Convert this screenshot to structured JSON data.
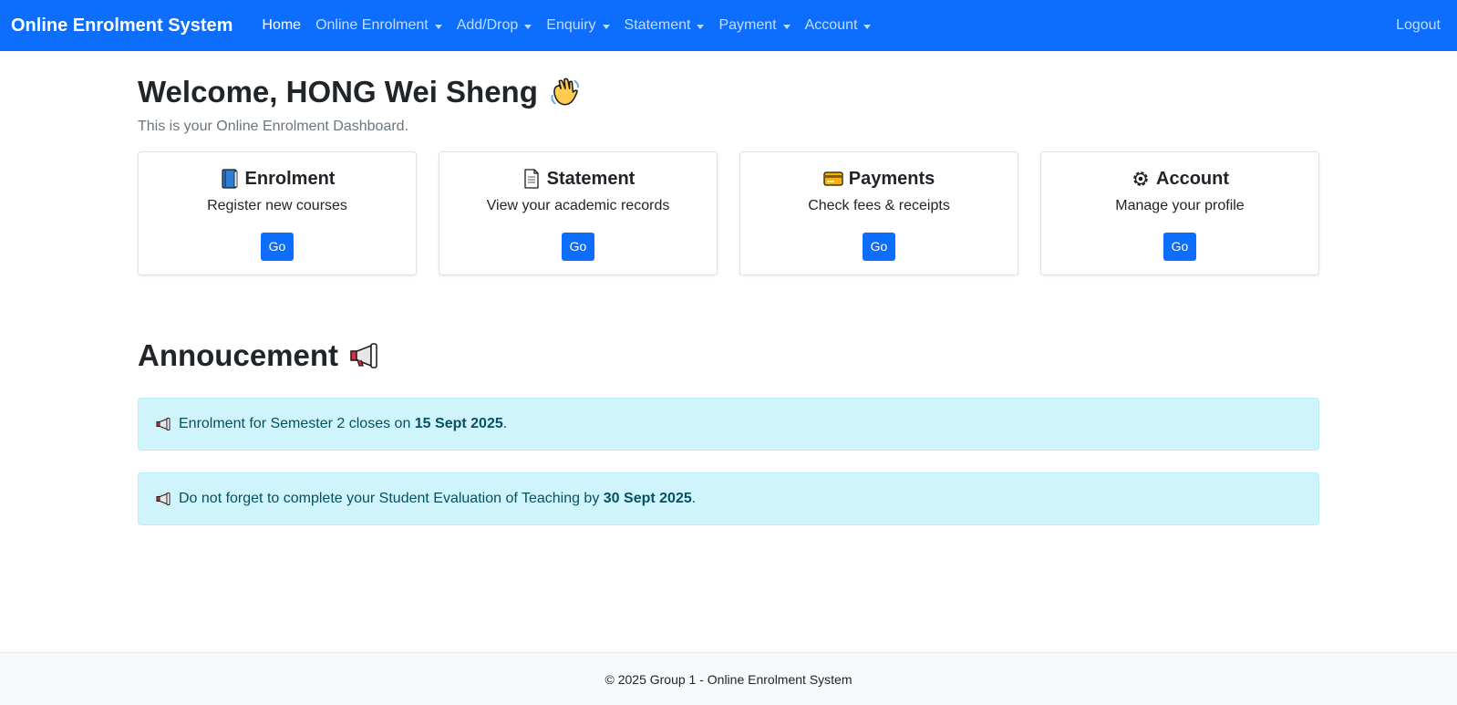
{
  "navbar": {
    "brand": "Online Enrolment System",
    "items": [
      {
        "label": "Home",
        "active": true,
        "dropdown": false
      },
      {
        "label": "Online Enrolment",
        "dropdown": true
      },
      {
        "label": "Add/Drop",
        "dropdown": true
      },
      {
        "label": "Enquiry",
        "dropdown": true
      },
      {
        "label": "Statement",
        "dropdown": true
      },
      {
        "label": "Payment",
        "dropdown": true
      },
      {
        "label": "Account",
        "dropdown": true
      }
    ],
    "logout": "Logout"
  },
  "main": {
    "welcome": "Welcome, HONG Wei Sheng",
    "welcome_icon": "waving-hand-icon",
    "subtitle": "This is your Online Enrolment Dashboard.",
    "cards": [
      {
        "icon": "book-icon",
        "title": "Enrolment",
        "text": "Register new courses",
        "button": "Go"
      },
      {
        "icon": "document-icon",
        "title": "Statement",
        "text": "View your academic records",
        "button": "Go"
      },
      {
        "icon": "credit-card-icon",
        "title": "Payments",
        "text": "Check fees & receipts",
        "button": "Go"
      },
      {
        "icon": "gear-icon",
        "title": "Account",
        "text": "Manage your profile",
        "button": "Go"
      }
    ],
    "announcement_title": "Annoucement",
    "announcements": [
      {
        "prefix": "Enrolment for Semester 2 closes on ",
        "bold": "15 Sept 2025",
        "suffix": "."
      },
      {
        "prefix": "Do not forget to complete your Student Evaluation of Teaching by ",
        "bold": "30 Sept 2025",
        "suffix": "."
      }
    ]
  },
  "footer": {
    "text": "© 2025 Group 1 - Online Enrolment System"
  },
  "colors": {
    "primary": "#0d6efd",
    "alert_bg": "#cff4fc",
    "alert_text": "#055160",
    "footer_bg": "#f8f9fa"
  }
}
